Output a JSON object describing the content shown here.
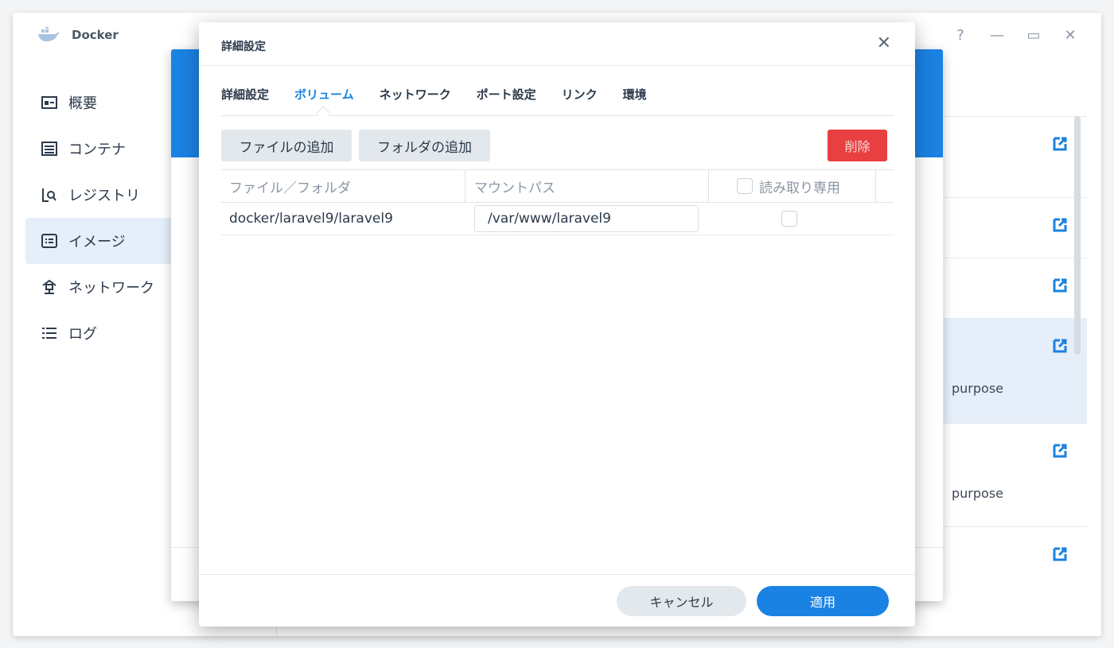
{
  "app": {
    "title": "Docker",
    "window_controls": [
      "?",
      "—",
      "▭",
      "✕"
    ]
  },
  "sidebar": {
    "items": [
      {
        "label": "概要",
        "icon": "overview-icon",
        "active": false
      },
      {
        "label": "コンテナ",
        "icon": "container-icon",
        "active": false
      },
      {
        "label": "レジストリ",
        "icon": "registry-icon",
        "active": false
      },
      {
        "label": "イメージ",
        "icon": "image-icon",
        "active": true
      },
      {
        "label": "ネットワーク",
        "icon": "network-icon",
        "active": false
      },
      {
        "label": "ログ",
        "icon": "log-icon",
        "active": false
      }
    ]
  },
  "background_list": {
    "rows": [
      {
        "text": "",
        "selected": false
      },
      {
        "text": "",
        "selected": false
      },
      {
        "text": "",
        "selected": false
      },
      {
        "text": "purpose",
        "selected": true
      },
      {
        "text": "purpose",
        "selected": false
      },
      {
        "text": "",
        "selected": false
      }
    ]
  },
  "dialog": {
    "title": "詳細設定",
    "close_label": "✕",
    "tabs": [
      {
        "label": "詳細設定",
        "active": false
      },
      {
        "label": "ボリューム",
        "active": true
      },
      {
        "label": "ネットワーク",
        "active": false
      },
      {
        "label": "ポート設定",
        "active": false
      },
      {
        "label": "リンク",
        "active": false
      },
      {
        "label": "環境",
        "active": false
      }
    ],
    "toolbar": {
      "add_file": "ファイルの追加",
      "add_folder": "フォルダの追加",
      "delete": "削除"
    },
    "table": {
      "columns": {
        "file_folder": "ファイル／フォルダ",
        "mount_path": "マウントパス",
        "read_only": "読み取り専用"
      },
      "rows": [
        {
          "file_folder": "docker/laravel9/laravel9",
          "mount_path": "/var/www/laravel9",
          "read_only": false
        }
      ]
    },
    "footer": {
      "cancel": "キャンセル",
      "apply": "適用"
    }
  },
  "colors": {
    "accent": "#1a82e2",
    "danger": "#e84040",
    "active_bg": "#e5eef9"
  }
}
